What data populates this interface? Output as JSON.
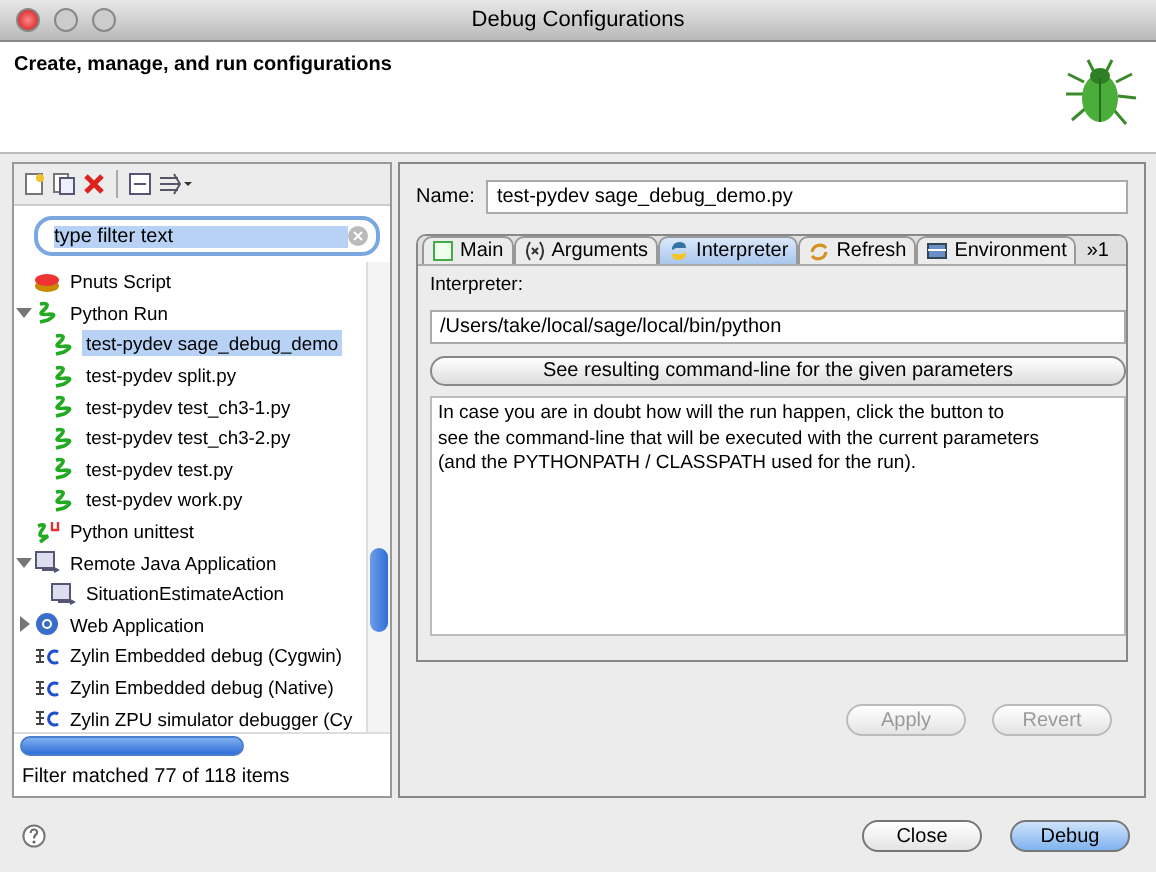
{
  "window": {
    "title": "Debug Configurations"
  },
  "header": {
    "title": "Create, manage, and run configurations"
  },
  "filter": {
    "placeholder": "type filter text"
  },
  "tree": [
    {
      "label": "Pnuts Script",
      "kind": "pnuts",
      "selected": false
    },
    {
      "label": "Python Run",
      "kind": "python",
      "selected": false,
      "expanded": true,
      "children": [
        {
          "label": "test-pydev sage_debug_demo",
          "kind": "python",
          "selected": true
        },
        {
          "label": "test-pydev split.py",
          "kind": "python",
          "selected": false
        },
        {
          "label": "test-pydev test_ch3-1.py",
          "kind": "python",
          "selected": false
        },
        {
          "label": "test-pydev test_ch3-2.py",
          "kind": "python",
          "selected": false
        },
        {
          "label": "test-pydev test.py",
          "kind": "python",
          "selected": false
        },
        {
          "label": "test-pydev work.py",
          "kind": "python",
          "selected": false
        }
      ]
    },
    {
      "label": "Python unittest",
      "kind": "unittest",
      "selected": false
    },
    {
      "label": "Remote Java Application",
      "kind": "java",
      "selected": false,
      "expanded": true,
      "children": [
        {
          "label": "SituationEstimateAction",
          "kind": "java",
          "selected": false
        }
      ]
    },
    {
      "label": "Web Application",
      "kind": "web",
      "selected": false,
      "expanded": false
    },
    {
      "label": "Zylin Embedded debug (Cygwin)",
      "kind": "zylin",
      "selected": false
    },
    {
      "label": "Zylin Embedded debug (Native)",
      "kind": "zylin",
      "selected": false
    },
    {
      "label": "Zylin ZPU simulator debugger (Cy",
      "kind": "zylin",
      "selected": false
    }
  ],
  "filter_status": "Filter matched 77 of 118 items",
  "name": {
    "label": "Name:",
    "value": "test-pydev sage_debug_demo.py"
  },
  "tabs": [
    {
      "label": "Main",
      "kind": "main",
      "selected": false
    },
    {
      "label": "Arguments",
      "kind": "args",
      "selected": false
    },
    {
      "label": "Interpreter",
      "kind": "interp",
      "selected": true
    },
    {
      "label": "Refresh",
      "kind": "refresh",
      "selected": false
    },
    {
      "label": "Environment",
      "kind": "env",
      "selected": false
    }
  ],
  "tab_overflow": "»1",
  "interpreter": {
    "label": "Interpreter:",
    "value": "/Users/take/local/sage/local/bin/python",
    "button": "See resulting command-line for the given parameters",
    "text": "In case you are in doubt how will the run happen, click the button to\nsee the command-line that will be executed with the current parameters\n(and the PYTHONPATH / CLASSPATH used for the run)."
  },
  "panel_buttons": [
    {
      "label": "Apply",
      "disabled": true
    },
    {
      "label": "Revert",
      "disabled": true
    }
  ],
  "dialog_buttons": [
    {
      "label": "Close",
      "default": false
    },
    {
      "label": "Debug",
      "default": true
    }
  ]
}
